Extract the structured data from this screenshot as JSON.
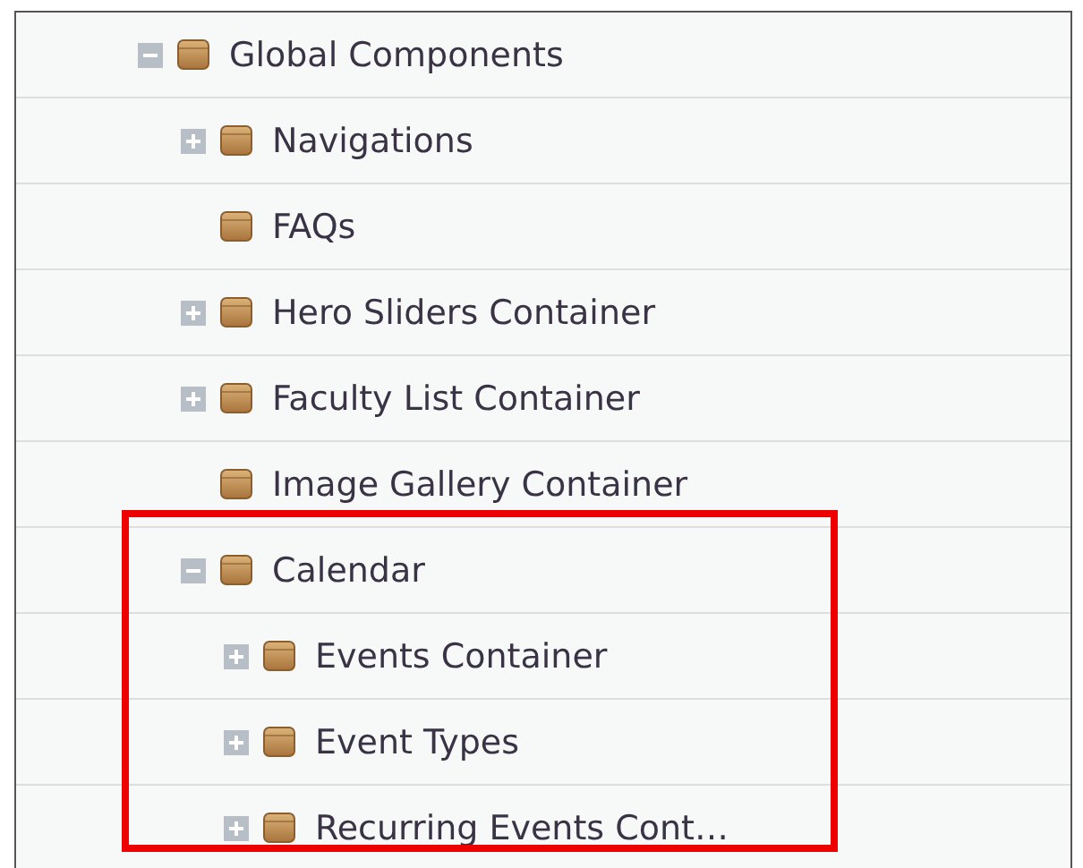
{
  "tree": [
    {
      "label": "Global Components",
      "kind": "branch",
      "expanded": true,
      "children": [
        {
          "label": "Navigations",
          "kind": "branch",
          "expanded": false
        },
        {
          "label": "FAQs",
          "kind": "leaf"
        },
        {
          "label": "Hero Sliders Container",
          "kind": "branch",
          "expanded": false
        },
        {
          "label": "Faculty List Container",
          "kind": "branch",
          "expanded": false
        },
        {
          "label": "Image Gallery Container",
          "kind": "leaf"
        },
        {
          "label": "Calendar",
          "kind": "branch",
          "expanded": true,
          "highlighted": true,
          "children": [
            {
              "label": "Events Container",
              "kind": "branch",
              "expanded": false
            },
            {
              "label": "Event Types",
              "kind": "branch",
              "expanded": false
            },
            {
              "label": "Recurring Events Cont…",
              "kind": "branch",
              "expanded": false
            }
          ]
        }
      ]
    }
  ]
}
